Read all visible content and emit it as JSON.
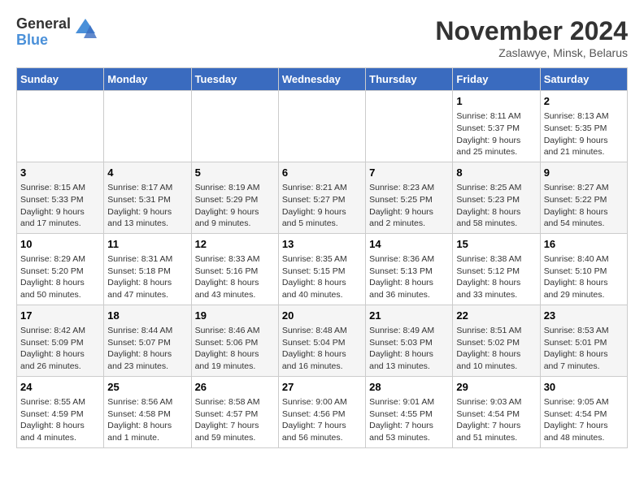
{
  "header": {
    "logo_general": "General",
    "logo_blue": "Blue",
    "month_title": "November 2024",
    "location": "Zaslawye, Minsk, Belarus"
  },
  "weekdays": [
    "Sunday",
    "Monday",
    "Tuesday",
    "Wednesday",
    "Thursday",
    "Friday",
    "Saturday"
  ],
  "weeks": [
    [
      {
        "day": "",
        "info": ""
      },
      {
        "day": "",
        "info": ""
      },
      {
        "day": "",
        "info": ""
      },
      {
        "day": "",
        "info": ""
      },
      {
        "day": "",
        "info": ""
      },
      {
        "day": "1",
        "info": "Sunrise: 8:11 AM\nSunset: 5:37 PM\nDaylight: 9 hours and 25 minutes."
      },
      {
        "day": "2",
        "info": "Sunrise: 8:13 AM\nSunset: 5:35 PM\nDaylight: 9 hours and 21 minutes."
      }
    ],
    [
      {
        "day": "3",
        "info": "Sunrise: 8:15 AM\nSunset: 5:33 PM\nDaylight: 9 hours and 17 minutes."
      },
      {
        "day": "4",
        "info": "Sunrise: 8:17 AM\nSunset: 5:31 PM\nDaylight: 9 hours and 13 minutes."
      },
      {
        "day": "5",
        "info": "Sunrise: 8:19 AM\nSunset: 5:29 PM\nDaylight: 9 hours and 9 minutes."
      },
      {
        "day": "6",
        "info": "Sunrise: 8:21 AM\nSunset: 5:27 PM\nDaylight: 9 hours and 5 minutes."
      },
      {
        "day": "7",
        "info": "Sunrise: 8:23 AM\nSunset: 5:25 PM\nDaylight: 9 hours and 2 minutes."
      },
      {
        "day": "8",
        "info": "Sunrise: 8:25 AM\nSunset: 5:23 PM\nDaylight: 8 hours and 58 minutes."
      },
      {
        "day": "9",
        "info": "Sunrise: 8:27 AM\nSunset: 5:22 PM\nDaylight: 8 hours and 54 minutes."
      }
    ],
    [
      {
        "day": "10",
        "info": "Sunrise: 8:29 AM\nSunset: 5:20 PM\nDaylight: 8 hours and 50 minutes."
      },
      {
        "day": "11",
        "info": "Sunrise: 8:31 AM\nSunset: 5:18 PM\nDaylight: 8 hours and 47 minutes."
      },
      {
        "day": "12",
        "info": "Sunrise: 8:33 AM\nSunset: 5:16 PM\nDaylight: 8 hours and 43 minutes."
      },
      {
        "day": "13",
        "info": "Sunrise: 8:35 AM\nSunset: 5:15 PM\nDaylight: 8 hours and 40 minutes."
      },
      {
        "day": "14",
        "info": "Sunrise: 8:36 AM\nSunset: 5:13 PM\nDaylight: 8 hours and 36 minutes."
      },
      {
        "day": "15",
        "info": "Sunrise: 8:38 AM\nSunset: 5:12 PM\nDaylight: 8 hours and 33 minutes."
      },
      {
        "day": "16",
        "info": "Sunrise: 8:40 AM\nSunset: 5:10 PM\nDaylight: 8 hours and 29 minutes."
      }
    ],
    [
      {
        "day": "17",
        "info": "Sunrise: 8:42 AM\nSunset: 5:09 PM\nDaylight: 8 hours and 26 minutes."
      },
      {
        "day": "18",
        "info": "Sunrise: 8:44 AM\nSunset: 5:07 PM\nDaylight: 8 hours and 23 minutes."
      },
      {
        "day": "19",
        "info": "Sunrise: 8:46 AM\nSunset: 5:06 PM\nDaylight: 8 hours and 19 minutes."
      },
      {
        "day": "20",
        "info": "Sunrise: 8:48 AM\nSunset: 5:04 PM\nDaylight: 8 hours and 16 minutes."
      },
      {
        "day": "21",
        "info": "Sunrise: 8:49 AM\nSunset: 5:03 PM\nDaylight: 8 hours and 13 minutes."
      },
      {
        "day": "22",
        "info": "Sunrise: 8:51 AM\nSunset: 5:02 PM\nDaylight: 8 hours and 10 minutes."
      },
      {
        "day": "23",
        "info": "Sunrise: 8:53 AM\nSunset: 5:01 PM\nDaylight: 8 hours and 7 minutes."
      }
    ],
    [
      {
        "day": "24",
        "info": "Sunrise: 8:55 AM\nSunset: 4:59 PM\nDaylight: 8 hours and 4 minutes."
      },
      {
        "day": "25",
        "info": "Sunrise: 8:56 AM\nSunset: 4:58 PM\nDaylight: 8 hours and 1 minute."
      },
      {
        "day": "26",
        "info": "Sunrise: 8:58 AM\nSunset: 4:57 PM\nDaylight: 7 hours and 59 minutes."
      },
      {
        "day": "27",
        "info": "Sunrise: 9:00 AM\nSunset: 4:56 PM\nDaylight: 7 hours and 56 minutes."
      },
      {
        "day": "28",
        "info": "Sunrise: 9:01 AM\nSunset: 4:55 PM\nDaylight: 7 hours and 53 minutes."
      },
      {
        "day": "29",
        "info": "Sunrise: 9:03 AM\nSunset: 4:54 PM\nDaylight: 7 hours and 51 minutes."
      },
      {
        "day": "30",
        "info": "Sunrise: 9:05 AM\nSunset: 4:54 PM\nDaylight: 7 hours and 48 minutes."
      }
    ]
  ]
}
